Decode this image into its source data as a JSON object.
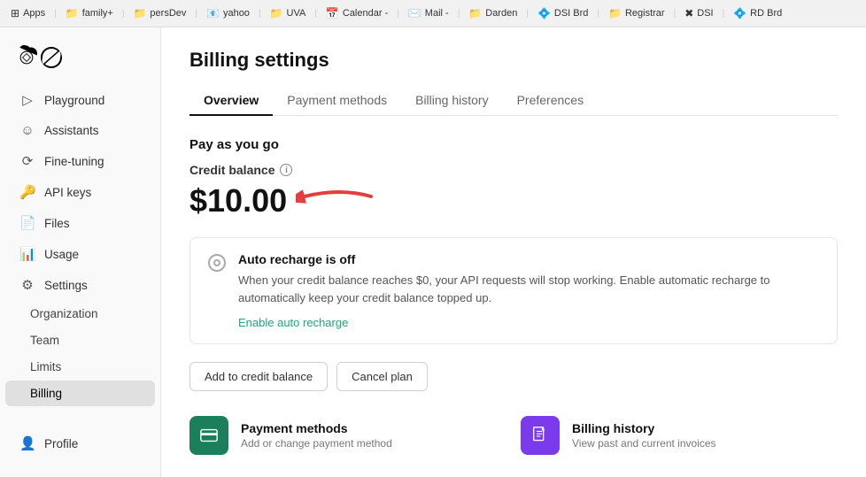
{
  "browser": {
    "tabs": [
      {
        "id": "apps",
        "label": "Apps",
        "icon": "⊞"
      },
      {
        "id": "family",
        "label": "family+",
        "icon": "📁"
      },
      {
        "id": "persdev",
        "label": "persDev",
        "icon": "📁"
      },
      {
        "id": "yahoo",
        "label": "yahoo",
        "icon": "📧"
      },
      {
        "id": "uva",
        "label": "UVA",
        "icon": "📁"
      },
      {
        "id": "calendar",
        "label": "Calendar -",
        "icon": "📅"
      },
      {
        "id": "mail",
        "label": "Mail -",
        "icon": "✉️"
      },
      {
        "id": "darden",
        "label": "Darden",
        "icon": "📁"
      },
      {
        "id": "dsibrd",
        "label": "DSI Brd",
        "icon": "💠"
      },
      {
        "id": "registrar",
        "label": "Registrar",
        "icon": "📁"
      },
      {
        "id": "dsi",
        "label": "DSI",
        "icon": "✖"
      },
      {
        "id": "rdbrd",
        "label": "RD Brd",
        "icon": "💠"
      }
    ]
  },
  "sidebar": {
    "items": [
      {
        "id": "playground",
        "label": "Playground",
        "icon": "▷"
      },
      {
        "id": "assistants",
        "label": "Assistants",
        "icon": "☺"
      },
      {
        "id": "fine-tuning",
        "label": "Fine-tuning",
        "icon": "⟳"
      },
      {
        "id": "api-keys",
        "label": "API keys",
        "icon": "🔑"
      },
      {
        "id": "files",
        "label": "Files",
        "icon": "📄"
      },
      {
        "id": "usage",
        "label": "Usage",
        "icon": "📊"
      },
      {
        "id": "settings",
        "label": "Settings",
        "icon": "⚙"
      }
    ],
    "sub_items": [
      {
        "id": "organization",
        "label": "Organization"
      },
      {
        "id": "team",
        "label": "Team"
      },
      {
        "id": "limits",
        "label": "Limits"
      },
      {
        "id": "billing",
        "label": "Billing",
        "active": true
      }
    ],
    "bottom_items": [
      {
        "id": "profile",
        "label": "Profile",
        "icon": "👤"
      }
    ]
  },
  "page": {
    "title": "Billing settings",
    "tabs": [
      {
        "id": "overview",
        "label": "Overview",
        "active": true
      },
      {
        "id": "payment-methods",
        "label": "Payment methods"
      },
      {
        "id": "billing-history",
        "label": "Billing history"
      },
      {
        "id": "preferences",
        "label": "Preferences"
      }
    ],
    "section_title": "Pay as you go",
    "credit_balance_label": "Credit balance",
    "credit_amount": "$10.00",
    "auto_recharge": {
      "title": "Auto recharge is off",
      "description": "When your credit balance reaches $0, your API requests will stop working. Enable automatic recharge to automatically keep your credit balance topped up.",
      "enable_link": "Enable auto recharge"
    },
    "buttons": {
      "add_credit": "Add to credit balance",
      "cancel_plan": "Cancel plan"
    },
    "cards": [
      {
        "id": "payment-methods",
        "color": "green",
        "icon": "💳",
        "title": "Payment methods",
        "description": "Add or change payment method"
      },
      {
        "id": "billing-history",
        "color": "purple",
        "icon": "📋",
        "title": "Billing history",
        "description": "View past and current invoices"
      }
    ]
  }
}
